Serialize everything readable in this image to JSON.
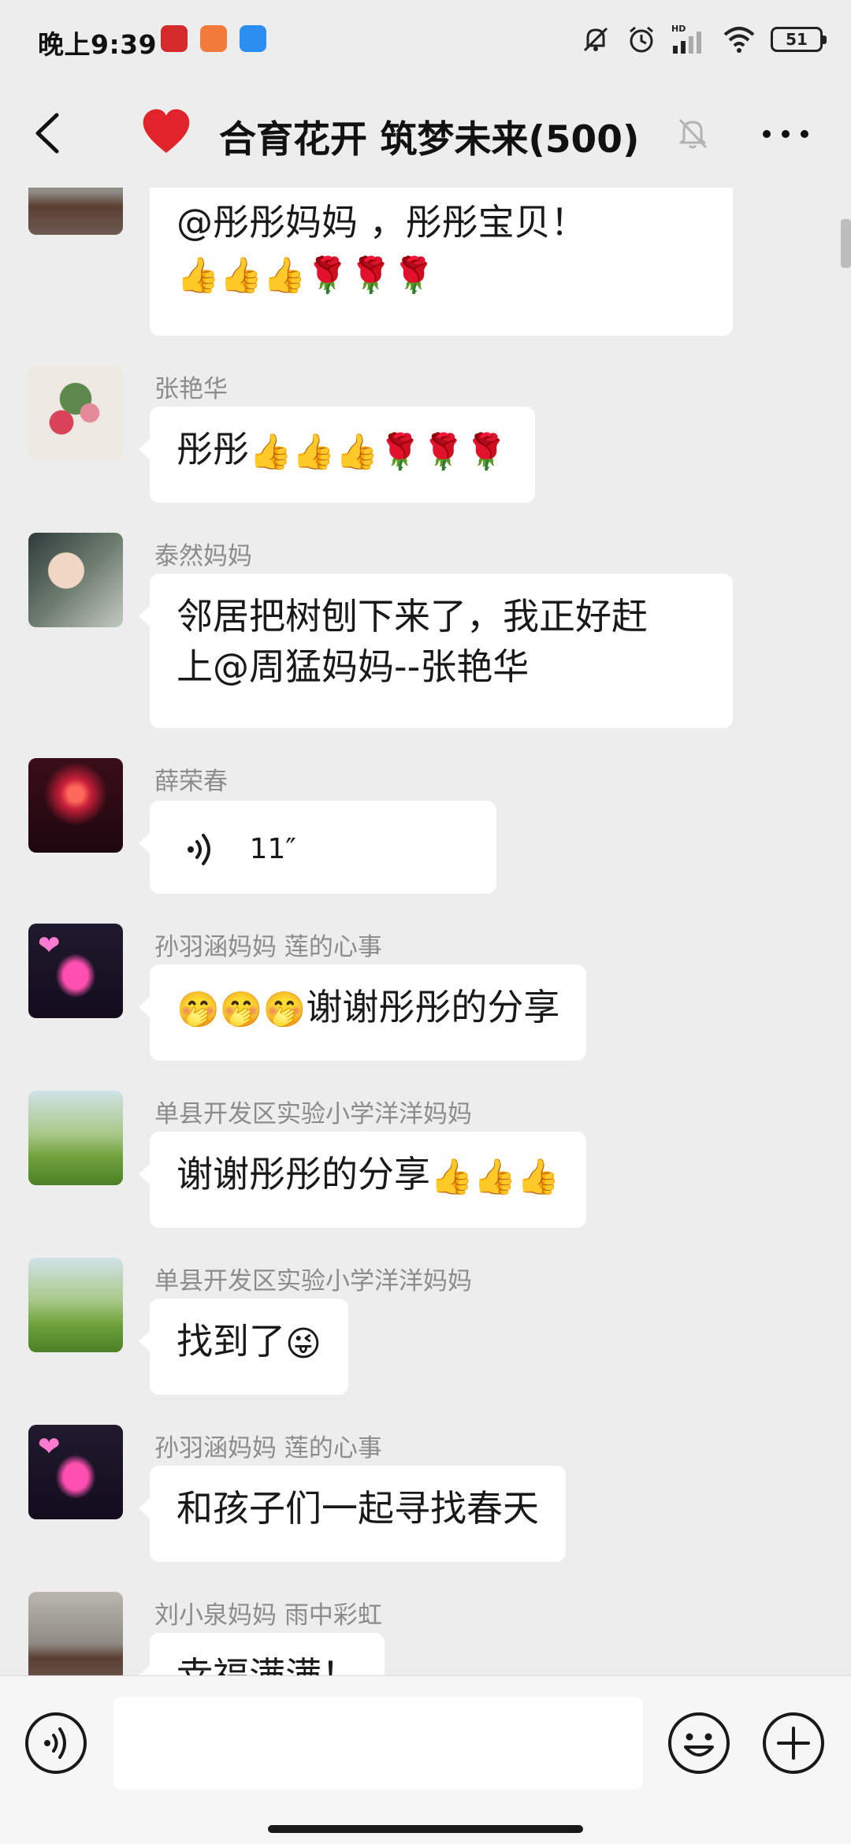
{
  "status_bar": {
    "time": "晚上9:39",
    "battery": "51",
    "network_label": "HD"
  },
  "nav": {
    "title": "合育花开 筑梦未来(500)",
    "heart_icon": "red-heart-icon",
    "mute_icon": "bell-off-icon"
  },
  "messages": [
    {
      "sender": "",
      "text": "@彤彤妈妈 ，彤彤宝贝！",
      "emojis": "👍👍👍🌹🌹🌹",
      "avatar": "lake-scene"
    },
    {
      "sender": "张艳华",
      "text": "彤彤",
      "emojis": "👍👍👍🌹🌹🌹",
      "avatar": "peony-painting"
    },
    {
      "sender": "泰然妈妈",
      "text_line1": "邻居把树刨下来了，我正好赶",
      "text_line2": "上@周猛妈妈--张艳华",
      "avatar": "woman-portrait"
    },
    {
      "sender": "薛荣春",
      "duration": "11″",
      "avatar": "fireworks"
    },
    {
      "sender": "孙羽涵妈妈  莲的心事",
      "emojis": "🤭🤭🤭",
      "text": "谢谢彤彤的分享",
      "avatar": "neon-sign"
    },
    {
      "sender": "单县开发区实验小学洋洋妈妈",
      "text": "谢谢彤彤的分享",
      "emojis": "👍👍👍",
      "avatar": "green-meadow"
    },
    {
      "sender": "单县开发区实验小学洋洋妈妈",
      "text": "找到了",
      "emojis": "😜",
      "avatar": "green-meadow"
    },
    {
      "sender": "孙羽涵妈妈  莲的心事",
      "text": "和孩子们一起寻找春天",
      "avatar": "neon-sign"
    },
    {
      "sender": "刘小泉妈妈  雨中彩虹",
      "text": "幸福满满！",
      "avatar": "lake-scene"
    }
  ],
  "input_bar": {
    "voice_icon": "voice-input-icon",
    "emoji_icon": "emoji-smile-icon",
    "plus_icon": "plus-circle-icon",
    "value": ""
  },
  "colors": {
    "background": "#ededed",
    "bubble": "#ffffff",
    "sender_text": "#8c8c8c",
    "heart": "#e0242a"
  }
}
